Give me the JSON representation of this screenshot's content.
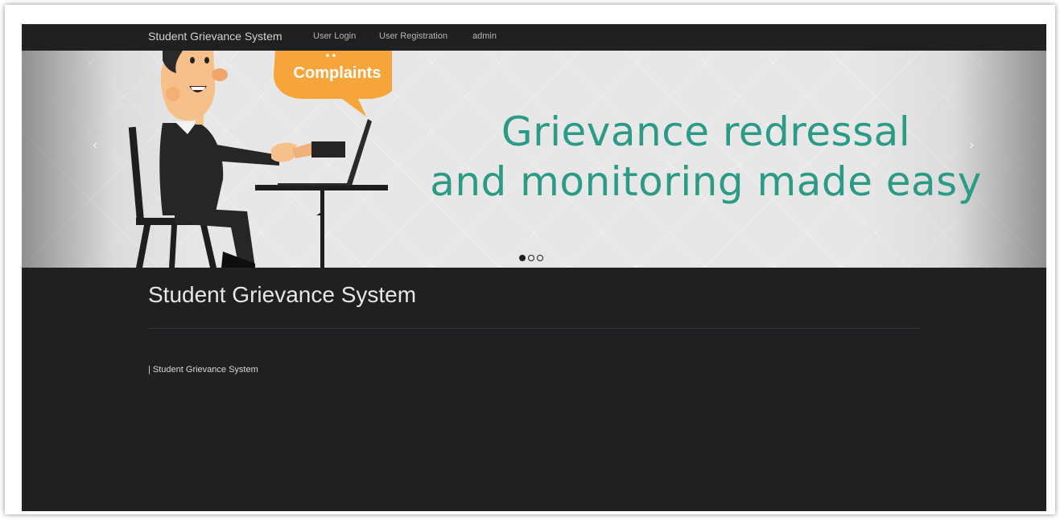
{
  "nav": {
    "brand": "Student Grievance System",
    "links": [
      "User Login",
      "User Registration",
      "admin"
    ]
  },
  "carousel": {
    "bubble_text": "Complaints",
    "headline_line1": "Grievance redressal",
    "headline_line2": "and monitoring made easy",
    "prev_icon": "‹",
    "next_icon": "›",
    "slide_count": 3,
    "active_slide": 1
  },
  "content": {
    "title": "Student Grievance System",
    "footer_text": "| Student Grievance System"
  },
  "colors": {
    "page_bg": "#1f2022",
    "headline": "#2b9a86",
    "bubble": "#f5a53a"
  }
}
